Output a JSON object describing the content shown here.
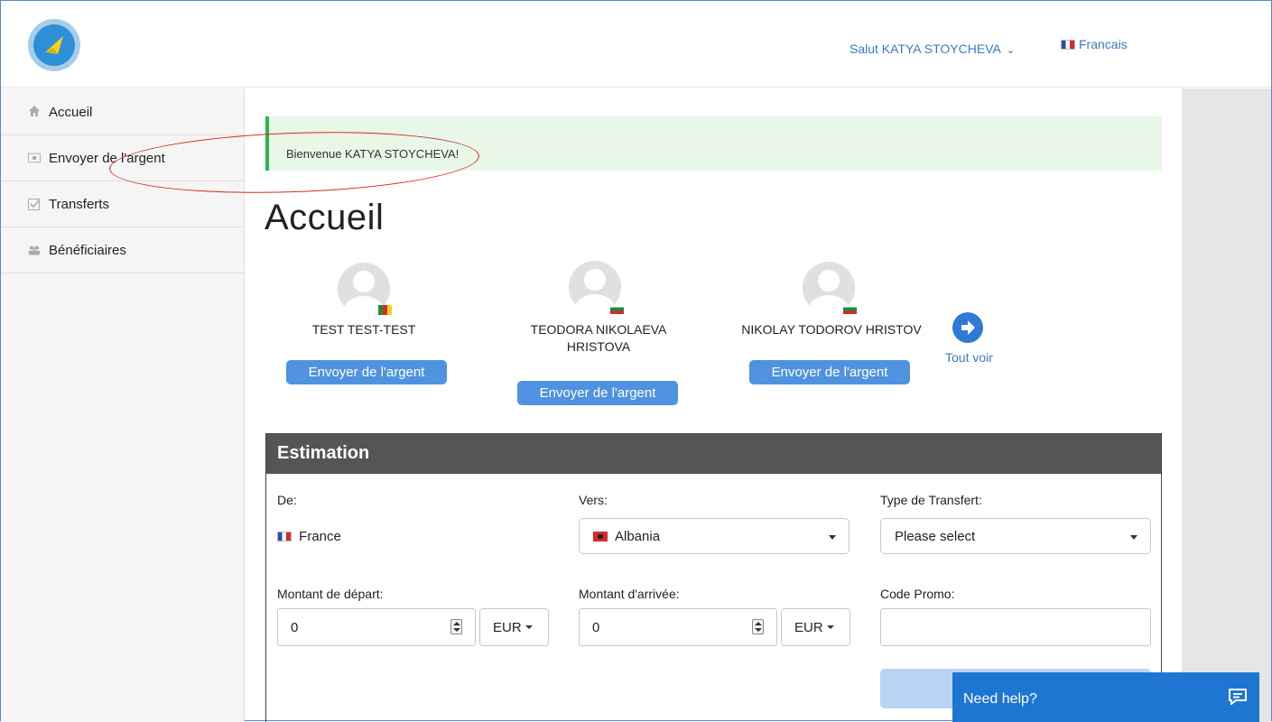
{
  "header": {
    "greeting": "Salut KATYA STOYCHEVA",
    "language": "Francais"
  },
  "sidebar": {
    "items": [
      {
        "label": "Accueil",
        "icon": "home-icon"
      },
      {
        "label": "Envoyer de l'argent",
        "icon": "money-icon"
      },
      {
        "label": "Transferts",
        "icon": "check-square-icon"
      },
      {
        "label": "Bénéficiaires",
        "icon": "users-icon"
      }
    ]
  },
  "alert": {
    "text": "Bienvenue KATYA STOYCHEVA!"
  },
  "page": {
    "title": "Accueil"
  },
  "beneficiaries": [
    {
      "name": "TEST TEST-TEST",
      "flag": "cameroon",
      "button": "Envoyer de l'argent"
    },
    {
      "name": "TEODORA NIKOLAEVA HRISTOVA",
      "flag": "bulgaria",
      "button": "Envoyer de l'argent"
    },
    {
      "name": "NIKOLAY TODOROV HRISTOV",
      "flag": "bulgaria",
      "button": "Envoyer de l'argent"
    }
  ],
  "see_all": "Tout voir",
  "estimation": {
    "title": "Estimation",
    "from_label": "De:",
    "from_value": "France",
    "to_label": "Vers:",
    "to_value": "Albania",
    "transfer_type_label": "Type de Transfert:",
    "transfer_type_value": "Please select",
    "send_amount_label": "Montant de départ:",
    "send_amount_value": "0",
    "send_currency": "EUR",
    "receive_amount_label": "Montant d'arrivée:",
    "receive_amount_value": "0",
    "receive_currency": "EUR",
    "promo_label": "Code Promo:",
    "promo_value": ""
  },
  "help": {
    "label": "Need help?"
  },
  "colors": {
    "primary": "#4f93e0",
    "alert_bg": "#e8f7e8",
    "alert_border": "#2fb34a",
    "card_head": "#555555",
    "annotation": "#d9281e"
  }
}
